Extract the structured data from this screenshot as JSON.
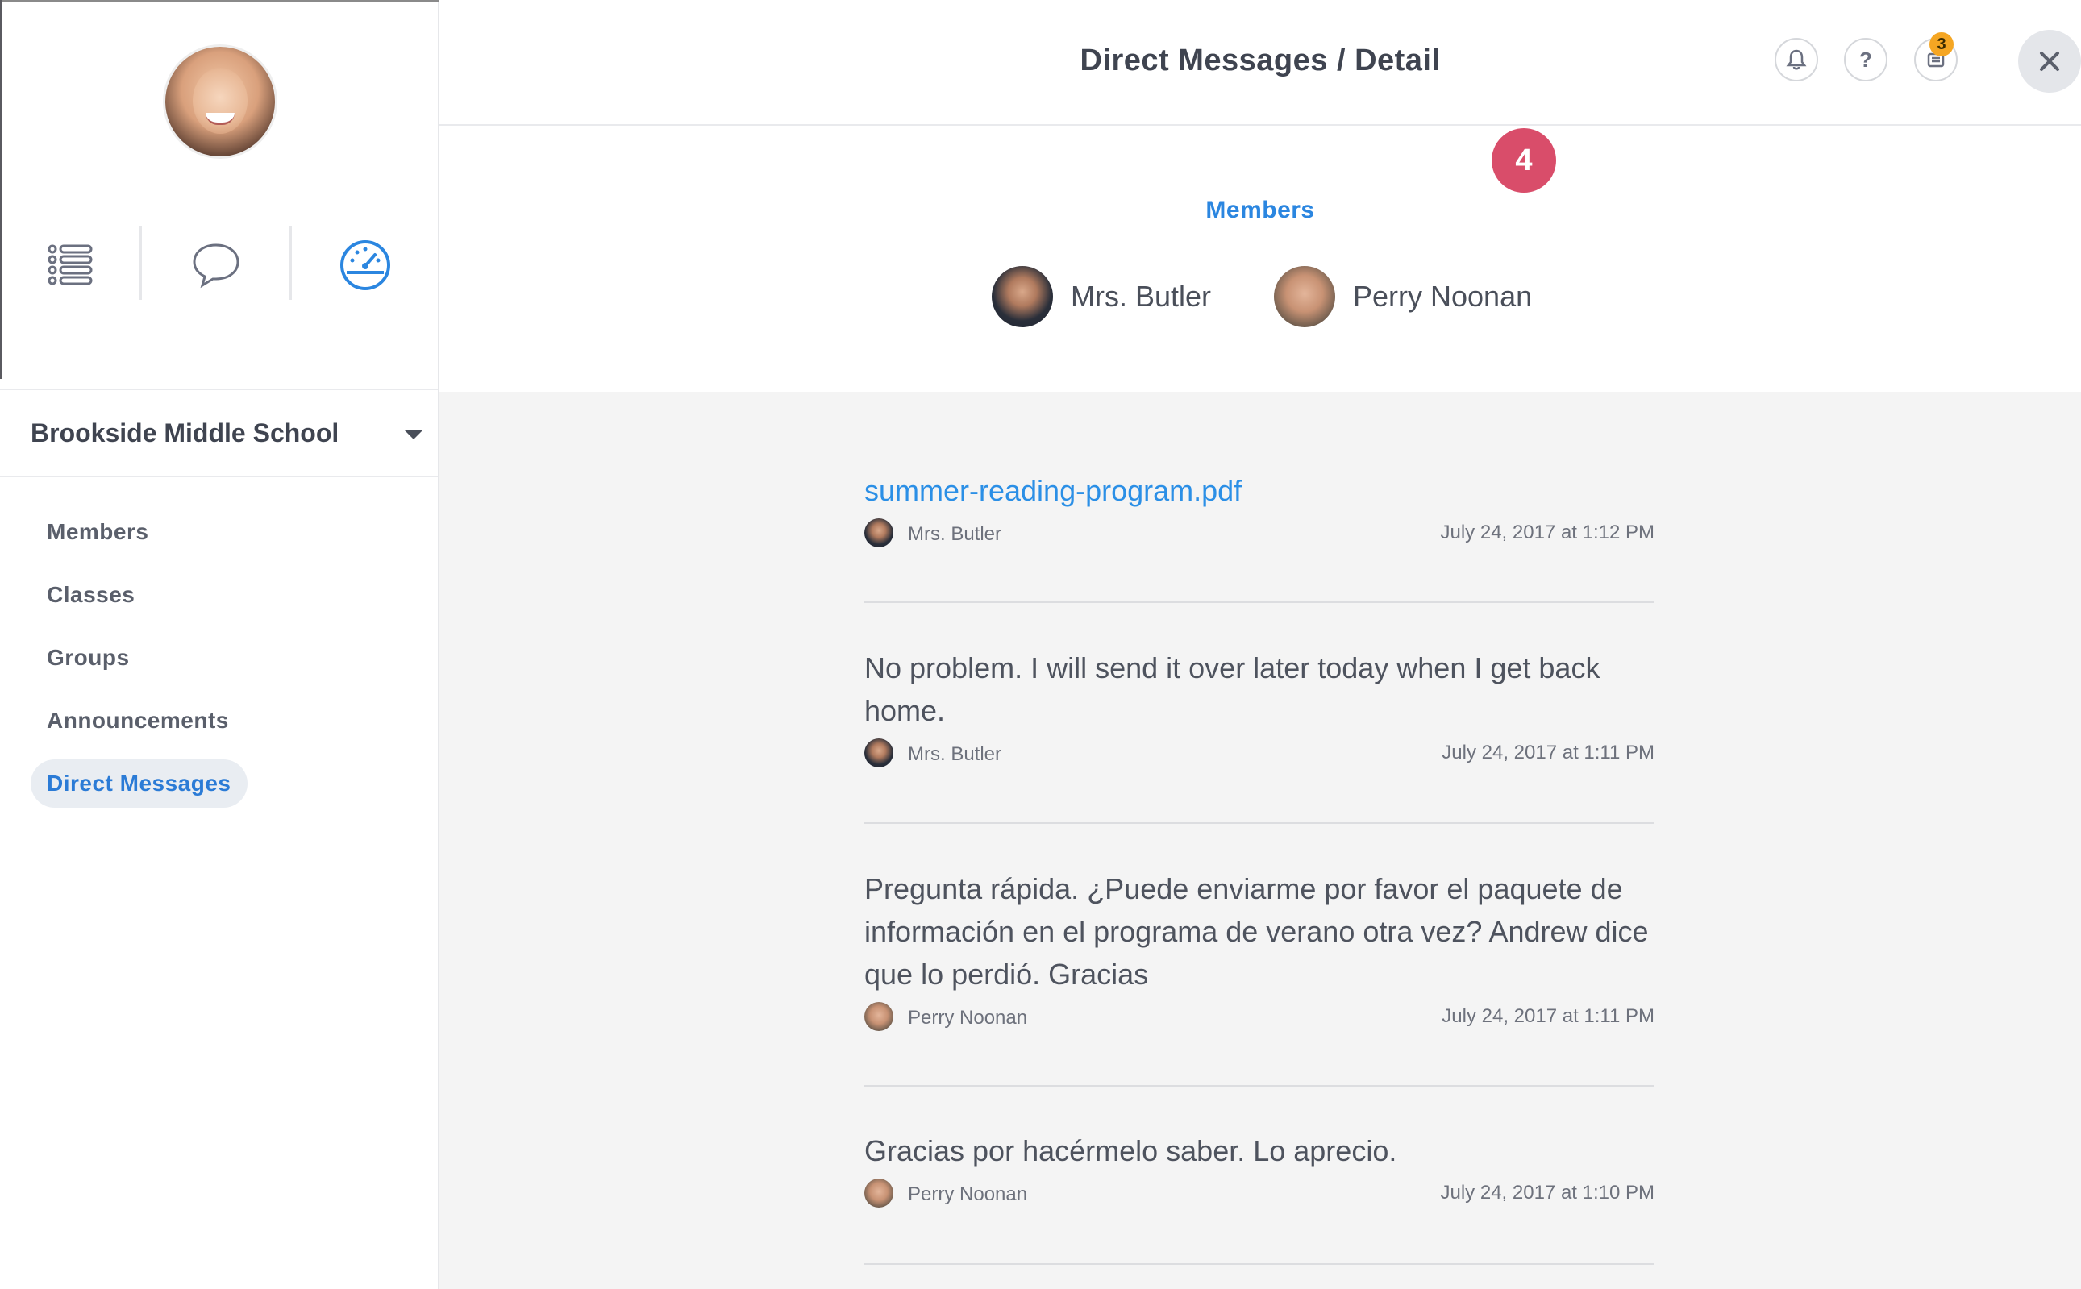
{
  "sidebar": {
    "school": "Brookside Middle School",
    "menu": [
      {
        "label": "Members",
        "active": false
      },
      {
        "label": "Classes",
        "active": false
      },
      {
        "label": "Groups",
        "active": false
      },
      {
        "label": "Announcements",
        "active": false
      },
      {
        "label": "Direct Messages",
        "active": true
      }
    ],
    "icons": [
      "list-icon",
      "chat-bubble-icon",
      "dashboard-gauge-icon"
    ]
  },
  "header": {
    "title": "Direct Messages / Detail",
    "icons": [
      "bell-icon",
      "help-icon",
      "inbox-icon",
      "close-icon"
    ],
    "inbox_badge": "3"
  },
  "step_badge": "4",
  "members": {
    "label": "Members",
    "people": [
      {
        "name": "Mrs. Butler"
      },
      {
        "name": "Perry Noonan"
      }
    ]
  },
  "messages": [
    {
      "text": "summer-reading-program.pdf",
      "is_attachment": true,
      "author": "Mrs. Butler",
      "time": "July 24, 2017 at 1:12 PM"
    },
    {
      "text": "No problem. I will send it over later today when I get back home.",
      "is_attachment": false,
      "author": "Mrs. Butler",
      "time": "July 24, 2017 at 1:11 PM"
    },
    {
      "text": "Pregunta rápida. ¿Puede enviarme por favor el paquete de información en el programa de verano otra vez? Andrew dice que lo perdió. Gracias",
      "is_attachment": false,
      "author": "Perry Noonan",
      "time": "July 24, 2017 at 1:11 PM"
    },
    {
      "text": "Gracias por hacérmelo saber. Lo aprecio.",
      "is_attachment": false,
      "author": "Perry Noonan",
      "time": "July 24, 2017 at 1:10 PM"
    }
  ],
  "colors": {
    "accent": "#2b86e0",
    "badge": "#f5a623",
    "step": "#d94d6a",
    "message_bg": "#f4f4f4"
  }
}
